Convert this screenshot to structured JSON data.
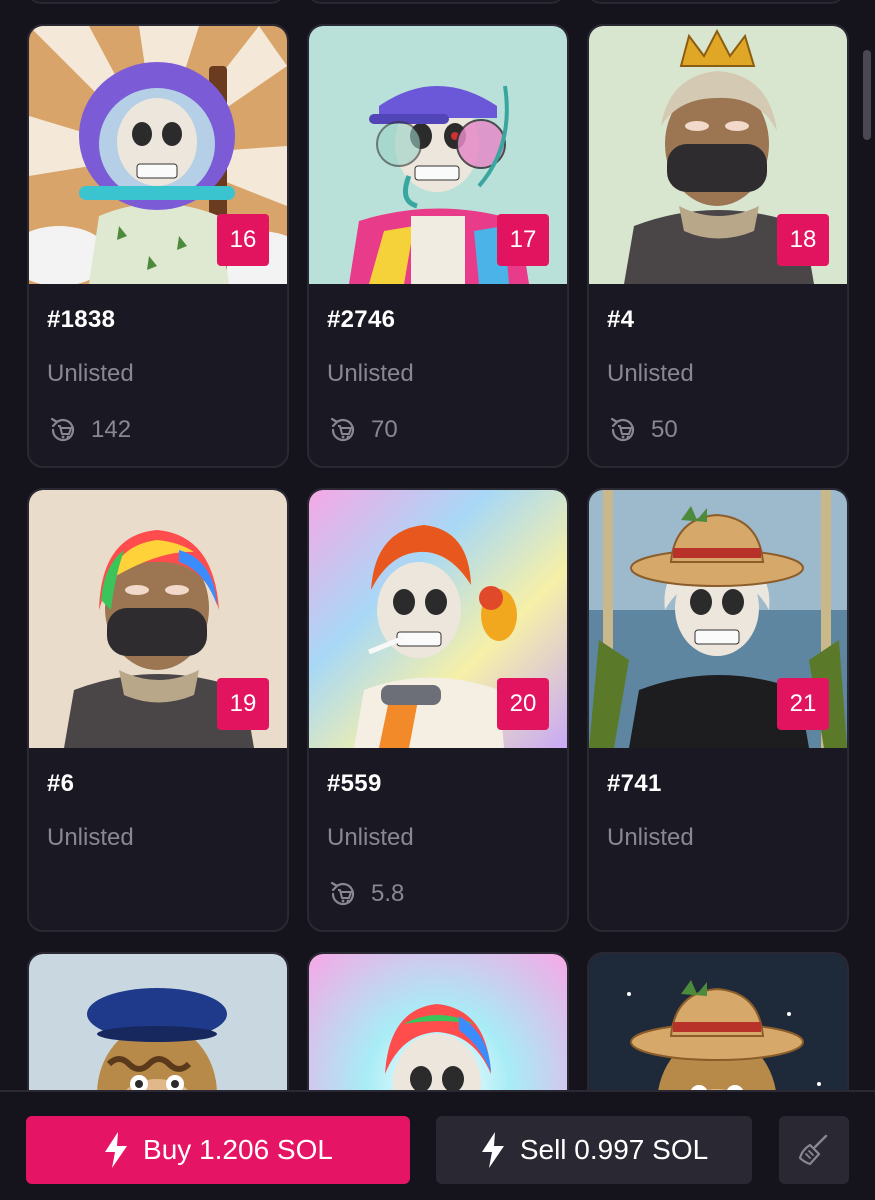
{
  "cards": [
    {
      "name": "#1838",
      "status": "Unlisted",
      "rank": "16",
      "sales": "142"
    },
    {
      "name": "#2746",
      "status": "Unlisted",
      "rank": "17",
      "sales": "70"
    },
    {
      "name": "#4",
      "status": "Unlisted",
      "rank": "18",
      "sales": "50"
    },
    {
      "name": "#6",
      "status": "Unlisted",
      "rank": "19",
      "sales": ""
    },
    {
      "name": "#559",
      "status": "Unlisted",
      "rank": "20",
      "sales": "5.8"
    },
    {
      "name": "#741",
      "status": "Unlisted",
      "rank": "21",
      "sales": ""
    }
  ],
  "actions": {
    "buy_label": "Buy 1.206 SOL",
    "sell_label": "Sell 0.997 SOL"
  },
  "icons": {
    "sales": "cart-refresh-icon",
    "buy": "lightning-bolt-icon",
    "sell": "lightning-bolt-icon",
    "sweep": "broom-icon"
  },
  "colors": {
    "accent": "#e3145f",
    "background": "#15131c",
    "card": "#1a1822",
    "muted_text": "#8a8794"
  }
}
